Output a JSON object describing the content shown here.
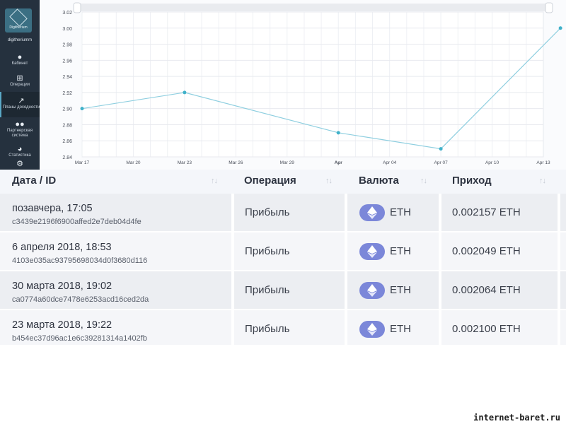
{
  "sidebar": {
    "logo_text": "Digitherium",
    "username": "digitheriumm",
    "items": [
      {
        "label": "Кабинет",
        "icon": "user-icon"
      },
      {
        "label": "Операции",
        "icon": "grid-icon"
      },
      {
        "label": "Планы доходности",
        "icon": "trend-icon"
      },
      {
        "label": "Партнерская система",
        "icon": "users-icon"
      },
      {
        "label": "Статистика",
        "icon": "pie-chart-icon"
      }
    ]
  },
  "chart_data": {
    "type": "line",
    "x": [
      "Mar 17",
      "Mar 23",
      "Apr 01",
      "Apr 07",
      "Apr 14"
    ],
    "values": [
      2.9,
      2.92,
      2.87,
      2.85,
      3.0
    ],
    "x_ticks": [
      "Mar 17",
      "Mar 20",
      "Mar 23",
      "Mar 26",
      "Mar 29",
      "Apr",
      "Apr 04",
      "Apr 07",
      "Apr 10",
      "Apr 13"
    ],
    "y_ticks": [
      "2.84",
      "2.86",
      "2.88",
      "2.90",
      "2.92",
      "2.94",
      "2.96",
      "2.98",
      "3.00",
      "3.02"
    ],
    "ylim": [
      2.84,
      3.02
    ],
    "grid": true,
    "color": "#8fcfe0"
  },
  "table": {
    "headers": [
      "Дата / ID",
      "Операция",
      "Валюта",
      "Приход"
    ],
    "rows": [
      {
        "date": "позавчера, 17:05",
        "hash": "c3439e2196f6900affed2e7deb04d4fe",
        "operation": "Прибыль",
        "currency": "ETH",
        "income": "0.002157 ETH"
      },
      {
        "date": "6 апреля 2018, 18:53",
        "hash": "4103e035ac93795698034d0f3680d116",
        "operation": "Прибыль",
        "currency": "ETH",
        "income": "0.002049 ETH"
      },
      {
        "date": "30 марта 2018, 19:02",
        "hash": "ca0774a60dce7478e6253acd16ced2da",
        "operation": "Прибыль",
        "currency": "ETH",
        "income": "0.002064 ETH"
      },
      {
        "date": "23 марта 2018, 19:22",
        "hash": "b454ec37d96ac1e6c39281314a1402fb",
        "operation": "Прибыль",
        "currency": "ETH",
        "income": "0.002100 ETH"
      }
    ]
  },
  "watermark": "internet-baret.ru",
  "colors": {
    "accent": "#7b87d9",
    "sidebar": "#25313e"
  }
}
